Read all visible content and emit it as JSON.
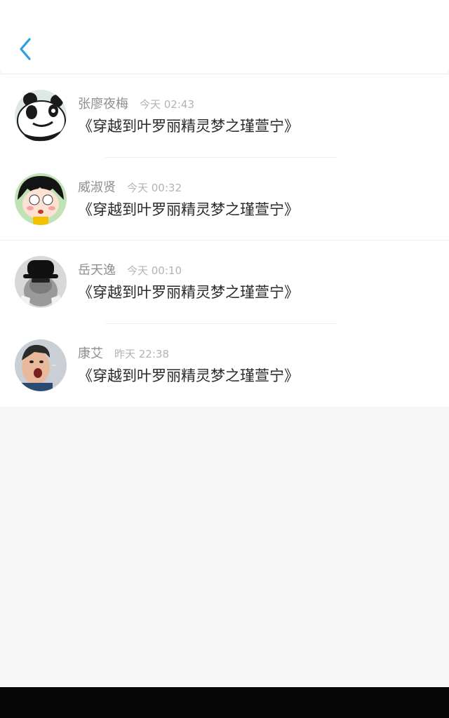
{
  "header": {
    "back_icon": "chevron-left-icon",
    "accent_color": "#2f9ee0"
  },
  "comments": [
    {
      "name": "张廖夜梅",
      "time": "今天 02:43",
      "content": "《穿越到叶罗丽精灵梦之瑾萱宁》",
      "avatar": "panda-avatar"
    },
    {
      "name": "威淑贤",
      "time": "今天 00:32",
      "content": "《穿越到叶罗丽精灵梦之瑾萱宁》",
      "avatar": "cartoon-girl-avatar"
    },
    {
      "name": "岳天逸",
      "time": "今天 00:10",
      "content": "《穿越到叶罗丽精灵梦之瑾萱宁》",
      "avatar": "cat-hat-avatar"
    },
    {
      "name": "康艾",
      "time": "昨天 22:38",
      "content": "《穿越到叶罗丽精灵梦之瑾萱宁》",
      "avatar": "boy-avatar"
    }
  ]
}
